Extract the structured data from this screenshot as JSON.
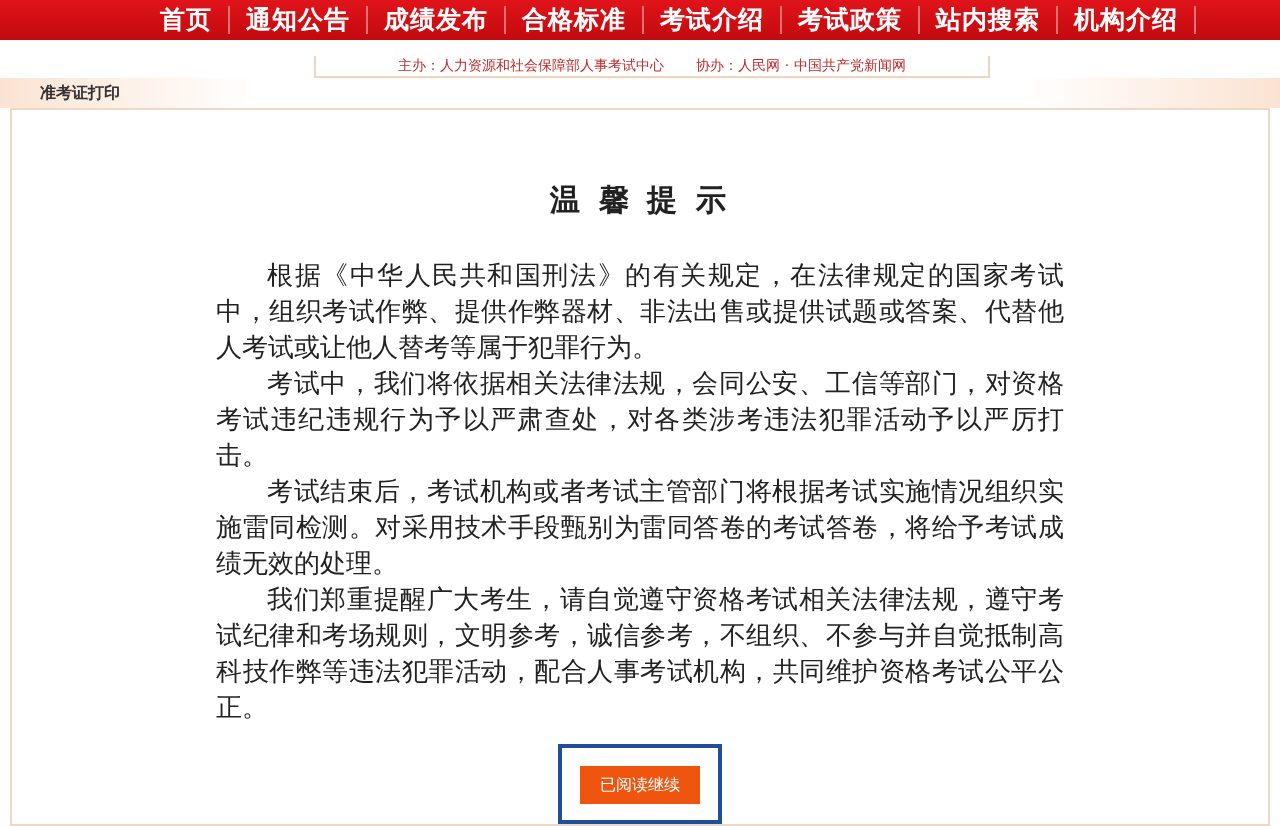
{
  "nav": {
    "items": [
      "首页",
      "通知公告",
      "成绩发布",
      "合格标准",
      "考试介绍",
      "考试政策",
      "站内搜索",
      "机构介绍"
    ]
  },
  "sponsors": [
    "主办：人力资源和社会保障部人事考试中心",
    "协办：人民网 · 中国共产党新闻网"
  ],
  "breadcrumb": "准考证打印",
  "notice": {
    "title": "温 馨 提 示",
    "paragraphs": [
      "根据《中华人民共和国刑法》的有关规定，在法律规定的国家考试中，组织考试作弊、提供作弊器材、非法出售或提供试题或答案、代替他人考试或让他人替考等属于犯罪行为。",
      "考试中，我们将依据相关法律法规，会同公安、工信等部门，对资格考试违纪违规行为予以严肃查处，对各类涉考违法犯罪活动予以严厉打击。",
      "考试结束后，考试机构或者考试主管部门将根据考试实施情况组织实施雷同检测。对采用技术手段甄别为雷同答卷的考试答卷，将给予考试成绩无效的处理。",
      "我们郑重提醒广大考生，请自觉遵守资格考试相关法律法规，遵守考试纪律和考场规则，文明参考，诚信参考，不组织、不参与并自觉抵制高科技作弊等违法犯罪活动，配合人事考试机构，共同维护资格考试公平公正。"
    ],
    "button": "已阅读继续"
  }
}
